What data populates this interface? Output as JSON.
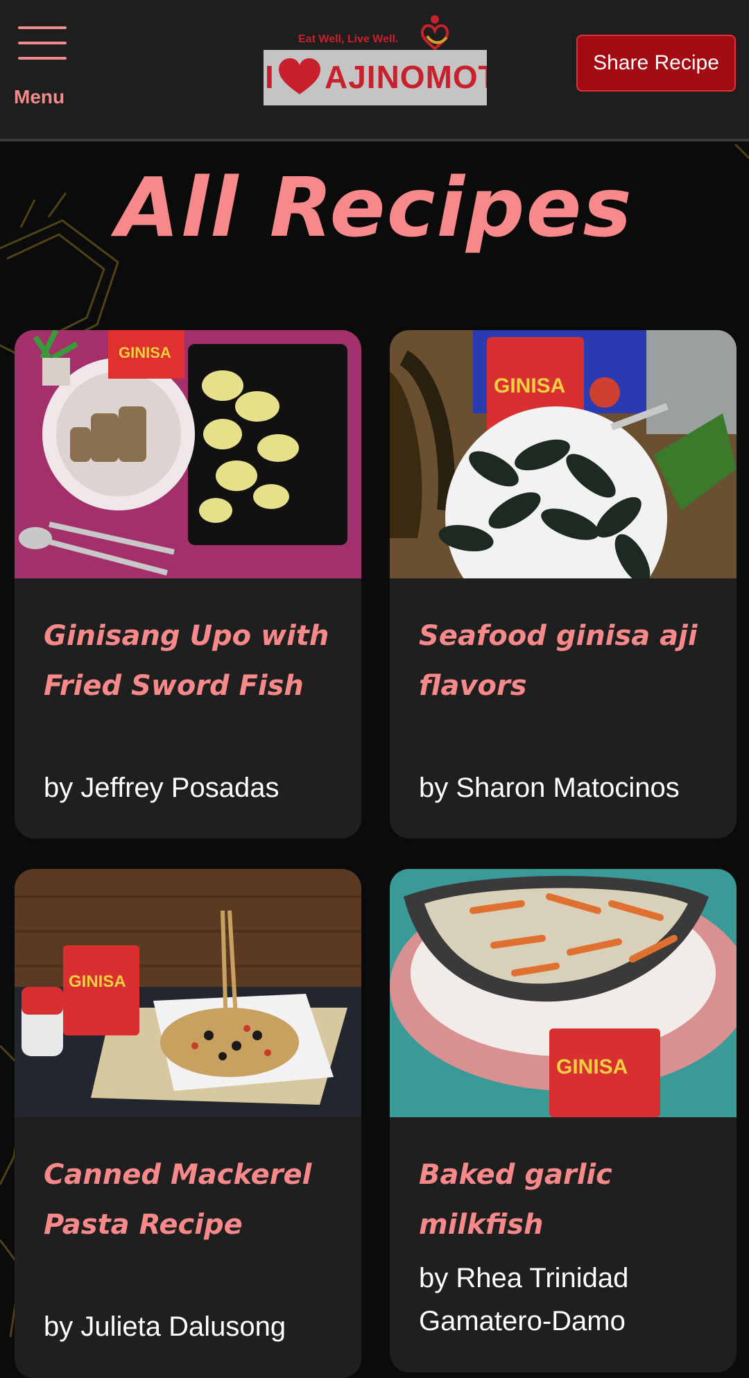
{
  "header": {
    "menu_label": "Menu",
    "tagline": "Eat Well, Live Well.",
    "brand_prefix": "I",
    "brand_name": "AJINOMOTO®",
    "share_button": "Share Recipe"
  },
  "page": {
    "title": "All Recipes"
  },
  "recipes": [
    {
      "title": "Ginisang Upo with Fried Sword Fish",
      "author": "by Jeffrey Posadas"
    },
    {
      "title": "Seafood ginisa aji flavors",
      "author": "by Sharon Matocinos"
    },
    {
      "title": "Canned Mackerel Pasta Recipe",
      "author": "by Julieta Dalusong"
    },
    {
      "title": "Baked garlic milkfish",
      "author": "by Rhea Trinidad Gamatero-Damo"
    }
  ],
  "colors": {
    "accent": "#f7898a",
    "brand_red": "#c8202c",
    "button": "#a30b12",
    "card": "#1f1f1f"
  },
  "icons": [
    "hamburger-menu-icon",
    "heart-icon"
  ]
}
